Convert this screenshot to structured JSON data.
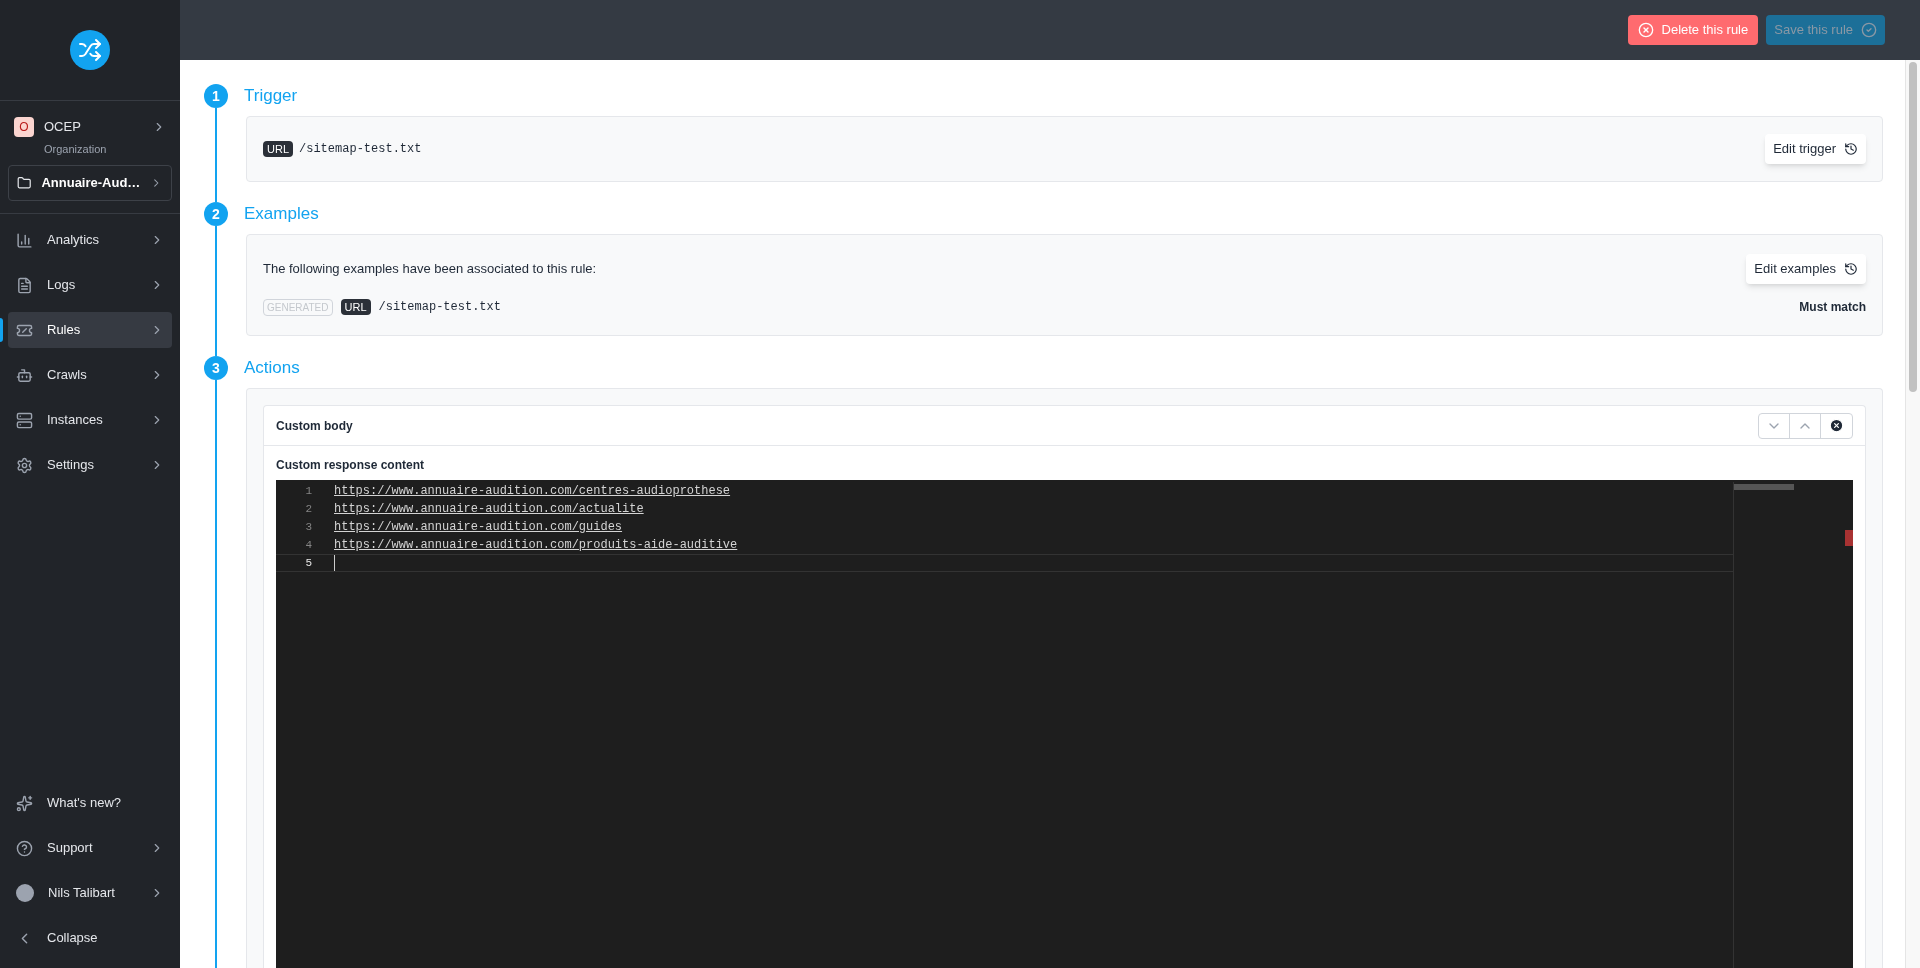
{
  "sidebar": {
    "organization": {
      "initial": "O",
      "name": "OCEP",
      "role": "Organization"
    },
    "project": "Annuaire-Aud…",
    "items": [
      {
        "label": "Analytics",
        "selected": false
      },
      {
        "label": "Logs",
        "selected": false
      },
      {
        "label": "Rules",
        "selected": true
      },
      {
        "label": "Crawls",
        "selected": false
      },
      {
        "label": "Instances",
        "selected": false
      },
      {
        "label": "Settings",
        "selected": false
      }
    ],
    "bottom": [
      {
        "label": "What's new?"
      },
      {
        "label": "Support"
      },
      {
        "label": "Nils Talibart"
      },
      {
        "label": "Collapse"
      }
    ]
  },
  "toolbar": {
    "delete": "Delete this rule",
    "save": {
      "label": "Save this rule",
      "disabled": true
    }
  },
  "steps": [
    {
      "number": "1",
      "title": "Trigger"
    },
    {
      "number": "2",
      "title": "Examples"
    },
    {
      "number": "3",
      "title": "Actions"
    }
  ],
  "trigger": {
    "tag": "URL",
    "value": "/sitemap-test.txt",
    "button": "Edit trigger"
  },
  "examples": {
    "intro": "The following examples have been associated to this rule:",
    "button": "Edit examples",
    "rows": [
      {
        "badge": "GENERATED",
        "tag": "URL",
        "value": "/sitemap-test.txt",
        "result": "Must match"
      }
    ]
  },
  "action": {
    "title": "Custom body",
    "field_label": "Custom response content",
    "lines": [
      {
        "number": "1",
        "text": "https://www.annuaire-audition.com/centres-audioprothese",
        "active": false
      },
      {
        "number": "2",
        "text": "https://www.annuaire-audition.com/actualite",
        "active": false
      },
      {
        "number": "3",
        "text": "https://www.annuaire-audition.com/guides",
        "active": false
      },
      {
        "number": "4",
        "text": "https://www.annuaire-audition.com/produits-aide-auditive",
        "active": false
      },
      {
        "number": "5",
        "active": true
      }
    ]
  }
}
